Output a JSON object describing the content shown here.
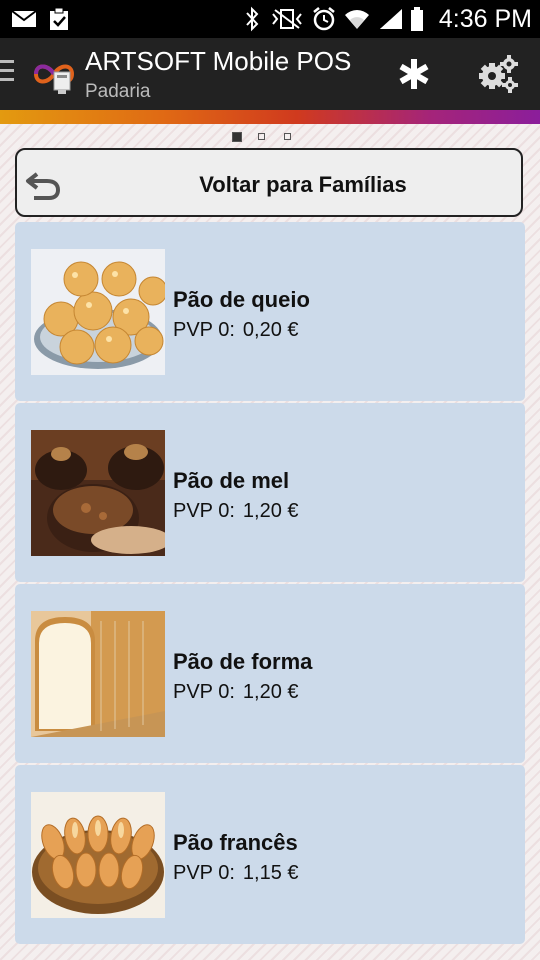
{
  "status_bar": {
    "time": "4:36 PM",
    "icons": [
      "mail-icon",
      "clipboard-check-icon",
      "bluetooth-icon",
      "vibrate-icon",
      "alarm-icon",
      "wifi-icon",
      "signal-icon",
      "battery-icon"
    ]
  },
  "app_bar": {
    "title": "ARTSOFT Mobile POS",
    "subtitle": "Padaria",
    "actions": [
      "asterisk-icon",
      "settings-gears-icon"
    ]
  },
  "page_indicator": {
    "count": 3,
    "active": 0
  },
  "back_button": {
    "label": "Voltar para Famílias",
    "icon": "back-arrow-icon"
  },
  "products": [
    {
      "name": "Pão de queio",
      "price_label": "PVP 0:",
      "price": "0,20 €",
      "image": "cheese-bread-image"
    },
    {
      "name": "Pão de mel",
      "price_label": "PVP 0:",
      "price": "1,20 €",
      "image": "honey-bread-image"
    },
    {
      "name": "Pão de forma",
      "price_label": "PVP 0:",
      "price": "1,20 €",
      "image": "sliced-loaf-image"
    },
    {
      "name": "Pão francês",
      "price_label": "PVP 0:",
      "price": "1,15 €",
      "image": "french-rolls-image"
    }
  ],
  "colors": {
    "status_bar": "#000000",
    "app_bar": "#222222",
    "card": "#ccdaea",
    "stripe_start": "#e39a10",
    "stripe_end": "#8b1e9b"
  }
}
